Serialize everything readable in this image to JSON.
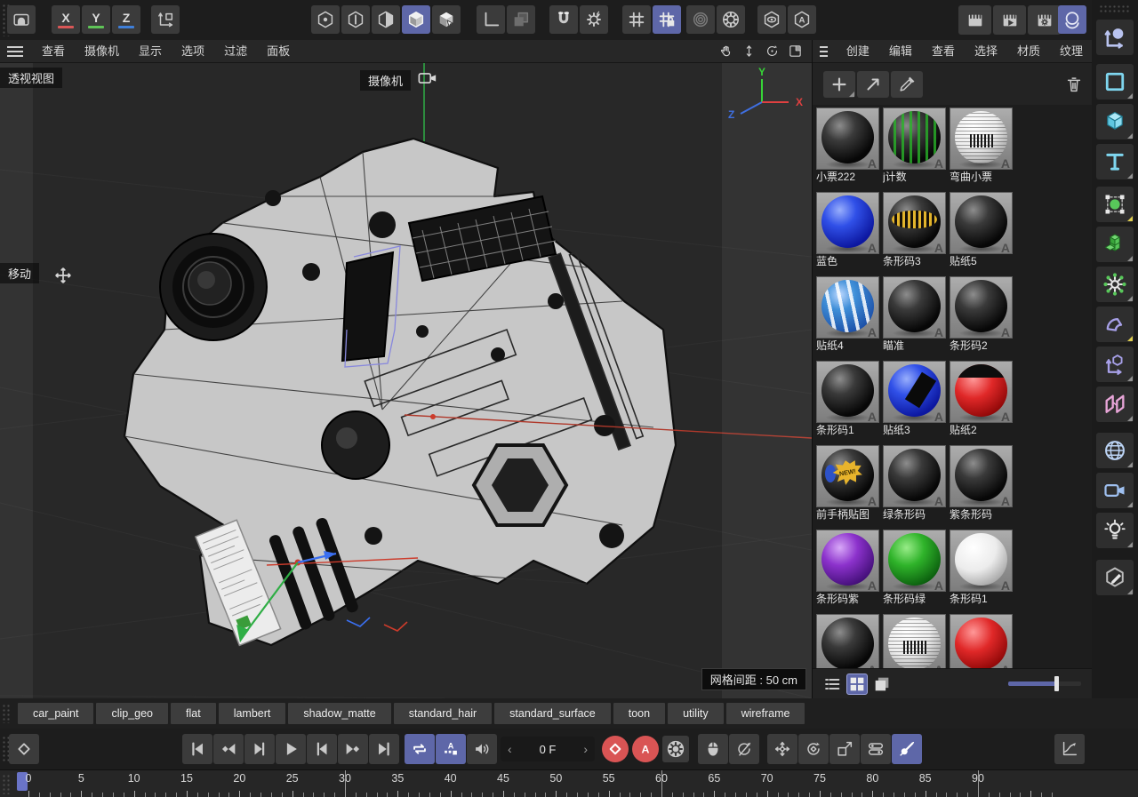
{
  "top_toolbar": {
    "capture": [
      {
        "name": "viewport-capture-icon"
      }
    ],
    "axis_buttons": [
      {
        "label": "X",
        "color": "#d95757"
      },
      {
        "label": "Y",
        "color": "#5fc457"
      },
      {
        "label": "Z",
        "color": "#3f7fd9"
      }
    ],
    "world": [
      {
        "name": "world-axis-icon"
      }
    ],
    "modes": [
      {
        "name": "points-mode-icon"
      },
      {
        "name": "edges-mode-icon"
      },
      {
        "name": "polygons-mode-icon"
      },
      {
        "name": "object-mode-icon",
        "active": true
      },
      {
        "name": "tweak-mode-icon"
      }
    ],
    "workplane": [
      {
        "name": "workplane-axis-icon"
      },
      {
        "name": "workplane-square-icon"
      }
    ],
    "snap": [
      {
        "name": "snap-magnet-icon"
      },
      {
        "name": "snap-settings-icon"
      }
    ],
    "grid": [
      {
        "name": "grid-toggle-icon"
      },
      {
        "name": "grid-lock-icon",
        "active": true
      }
    ],
    "rings": [
      {
        "name": "rings-icon"
      },
      {
        "name": "gear-ring-icon"
      }
    ],
    "visibility": [
      {
        "name": "eye-hexagon-icon"
      },
      {
        "name": "a-hexagon-icon"
      }
    ],
    "render": [
      {
        "name": "render-view-icon"
      },
      {
        "name": "render-play-icon"
      },
      {
        "name": "render-settings-icon"
      }
    ],
    "renderer": [
      {
        "name": "arnold-renderer-icon",
        "active": true
      }
    ]
  },
  "viewport": {
    "menu": [
      "查看",
      "摄像机",
      "显示",
      "选项",
      "过滤",
      "面板"
    ],
    "nav_icons": [
      {
        "name": "pan-hand-icon"
      },
      {
        "name": "zoom-view-icon"
      },
      {
        "name": "orbit-view-icon"
      },
      {
        "name": "frame-view-icon"
      }
    ],
    "view_label": "透视视图",
    "camera_label": "摄像机",
    "tool_label": "移动",
    "grid_spacing_label": "网格间距 : 50 cm",
    "axis_gizmo": {
      "x": "X",
      "y": "Y",
      "z": "Z"
    }
  },
  "materials_panel": {
    "menu": [
      "创建",
      "编辑",
      "查看",
      "选择",
      "材质",
      "纹理"
    ],
    "toolbar": [
      {
        "name": "add-material-icon"
      },
      {
        "name": "assign-material-icon"
      },
      {
        "name": "eyedropper-icon"
      }
    ],
    "trash": [
      {
        "name": "trash-icon"
      }
    ],
    "badge": "A",
    "materials": [
      {
        "label": "小票222",
        "style": "black"
      },
      {
        "label": "j计数",
        "style": "green-stripes"
      },
      {
        "label": "弯曲小票",
        "style": "white-barcode"
      },
      {
        "label": "蓝色",
        "style": "blue"
      },
      {
        "label": "条形码3",
        "style": "gold-band"
      },
      {
        "label": "贴纸5",
        "style": "black"
      },
      {
        "label": "贴纸4",
        "style": "blue-sticker"
      },
      {
        "label": "瞄准",
        "style": "black"
      },
      {
        "label": "条形码2",
        "style": "black"
      },
      {
        "label": "条形码1",
        "style": "black"
      },
      {
        "label": "贴纸3",
        "style": "blue-black"
      },
      {
        "label": "贴纸2",
        "style": "red-black"
      },
      {
        "label": "前手柄贴图",
        "style": "new-sticker"
      },
      {
        "label": "绿条形码",
        "style": "black"
      },
      {
        "label": "紫条形码",
        "style": "black"
      },
      {
        "label": "条形码紫",
        "style": "purple"
      },
      {
        "label": "条形码绿",
        "style": "green"
      },
      {
        "label": "条形码1",
        "style": "white"
      },
      {
        "label": "",
        "style": "black"
      },
      {
        "label": "",
        "style": "white-barcode"
      },
      {
        "label": "",
        "style": "red"
      }
    ],
    "view_icons": [
      {
        "name": "list-view-icon"
      },
      {
        "name": "grid-view-icon",
        "active": true
      },
      {
        "name": "layer-view-icon"
      }
    ]
  },
  "sidebar": {
    "icons": [
      {
        "name": "move-axis-icon"
      },
      {
        "name": "spline-rect-icon",
        "tri": "g"
      },
      {
        "name": "cube-primitive-icon",
        "tri": "g"
      },
      {
        "name": "text-object-icon",
        "tri": "g"
      },
      {
        "name": "subdivision-surface-icon",
        "tri": "y"
      },
      {
        "name": "volume-builder-icon",
        "tri": "g"
      },
      {
        "name": "dynamics-icon",
        "tri": "g"
      },
      {
        "name": "bend-deformer-icon",
        "tri": "y"
      },
      {
        "name": "null-axis-icon",
        "tri": "g"
      },
      {
        "name": "symmetry-icon",
        "tri": "g"
      },
      {
        "name": "environment-globe-icon",
        "tri": "g"
      },
      {
        "name": "scene-camera-icon",
        "tri": "g"
      },
      {
        "name": "light-icon",
        "tri": "g"
      },
      {
        "name": "material-edit-icon",
        "tri": "g"
      }
    ]
  },
  "tabs": [
    "car_paint",
    "clip_geo",
    "flat",
    "lambert",
    "shadow_matte",
    "standard_hair",
    "standard_surface",
    "toon",
    "utility",
    "wireframe"
  ],
  "playback": {
    "keyframe": [
      {
        "name": "set-keyframe-icon"
      }
    ],
    "transport": [
      {
        "name": "go-start-icon"
      },
      {
        "name": "prev-key-icon"
      },
      {
        "name": "prev-frame-icon"
      },
      {
        "name": "play-icon"
      },
      {
        "name": "next-frame-icon"
      },
      {
        "name": "next-key-icon"
      },
      {
        "name": "go-end-icon"
      }
    ],
    "toggles": [
      {
        "name": "loop-icon",
        "active": true
      },
      {
        "name": "autokey-range-icon",
        "active": true
      },
      {
        "name": "sound-icon"
      }
    ],
    "frame_display": {
      "value": "0 F",
      "prev": "‹",
      "next": "›"
    },
    "record": [
      {
        "name": "record-keyframe-icon",
        "red": true
      },
      {
        "name": "record-autokey-icon",
        "red": true
      },
      {
        "name": "record-settings-icon"
      }
    ],
    "input_mode": [
      {
        "name": "mouse-icon"
      },
      {
        "name": "rotate-record-icon"
      }
    ],
    "key_filters": [
      {
        "name": "key-position-icon"
      },
      {
        "name": "key-rotation-icon"
      },
      {
        "name": "key-scale-icon"
      },
      {
        "name": "key-params-icon"
      },
      {
        "name": "key-filter-icon",
        "active": true
      }
    ],
    "fcurve": [
      {
        "name": "fcurve-editor-icon"
      }
    ]
  },
  "timeline": {
    "start": 0,
    "end": 90,
    "label_step": 5,
    "second_marks": [
      30,
      60,
      90
    ],
    "playhead_frame": 0
  }
}
